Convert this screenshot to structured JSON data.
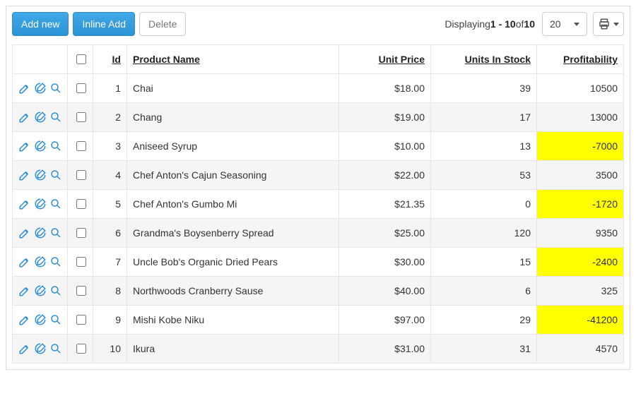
{
  "toolbar": {
    "add_new": "Add new",
    "inline_add": "Inline Add",
    "delete": "Delete"
  },
  "pager": {
    "prefix": "Displaying ",
    "range": "1 - 10",
    "of": " of ",
    "total": "10",
    "page_size": "20"
  },
  "columns": {
    "id": "Id",
    "product_name": "Product Name",
    "unit_price": "Unit Price",
    "units_in_stock": "Units In Stock",
    "profitability": "Profitability"
  },
  "rows": [
    {
      "id": "1",
      "name": "Chai",
      "price": "$18.00",
      "stock": "39",
      "profit": "10500",
      "neg": false
    },
    {
      "id": "2",
      "name": "Chang",
      "price": "$19.00",
      "stock": "17",
      "profit": "13000",
      "neg": false
    },
    {
      "id": "3",
      "name": "Aniseed Syrup",
      "price": "$10.00",
      "stock": "13",
      "profit": "-7000",
      "neg": true
    },
    {
      "id": "4",
      "name": "Chef Anton's Cajun Seasoning",
      "price": "$22.00",
      "stock": "53",
      "profit": "3500",
      "neg": false
    },
    {
      "id": "5",
      "name": "Chef Anton's Gumbo Mi",
      "price": "$21.35",
      "stock": "0",
      "profit": "-1720",
      "neg": true
    },
    {
      "id": "6",
      "name": "Grandma's Boysenberry Spread",
      "price": "$25.00",
      "stock": "120",
      "profit": "9350",
      "neg": false
    },
    {
      "id": "7",
      "name": "Uncle Bob's Organic Dried Pears",
      "price": "$30.00",
      "stock": "15",
      "profit": "-2400",
      "neg": true
    },
    {
      "id": "8",
      "name": "Northwoods Cranberry Sause",
      "price": "$40.00",
      "stock": "6",
      "profit": "325",
      "neg": false
    },
    {
      "id": "9",
      "name": "Mishi Kobe Niku",
      "price": "$97.00",
      "stock": "29",
      "profit": "-41200",
      "neg": true
    },
    {
      "id": "10",
      "name": "Ikura",
      "price": "$31.00",
      "stock": "31",
      "profit": "4570",
      "neg": false
    }
  ]
}
